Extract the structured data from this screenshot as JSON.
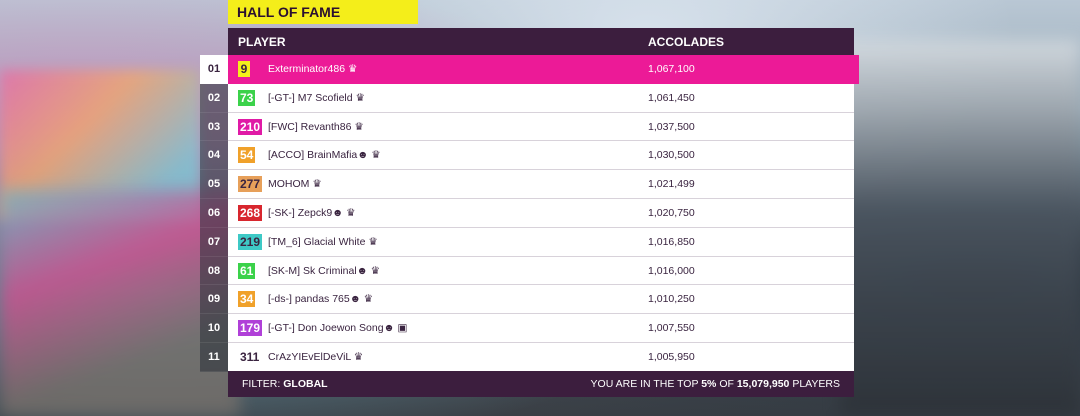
{
  "title": "HALL OF FAME",
  "headers": {
    "player": "PLAYER",
    "accolades": "ACCOLADES"
  },
  "rows": [
    {
      "rank": "01",
      "level": "9",
      "level_color": "#f4ee1a",
      "level_text_color": "#3a2440",
      "name": "Exterminator486 ♛",
      "accolades": "1,067,100",
      "highlight": true
    },
    {
      "rank": "02",
      "level": "73",
      "level_color": "#3bd24a",
      "level_text_color": "#ffffff",
      "name": "[-GT-] M7 Scofield ♛",
      "accolades": "1,061,450"
    },
    {
      "rank": "03",
      "level": "210",
      "level_color": "#e01aa6",
      "level_text_color": "#ffffff",
      "name": "[FWC] Revanth86 ♛",
      "accolades": "1,037,500"
    },
    {
      "rank": "04",
      "level": "54",
      "level_color": "#f0a12a",
      "level_text_color": "#ffffff",
      "name": "[ACCO] BrainMafia☻ ♛",
      "accolades": "1,030,500"
    },
    {
      "rank": "05",
      "level": "277",
      "level_color": "#e7a05a",
      "level_text_color": "#3a2440",
      "name": "MOHOM ♛",
      "accolades": "1,021,499"
    },
    {
      "rank": "06",
      "level": "268",
      "level_color": "#d8262e",
      "level_text_color": "#ffffff",
      "name": "[-SK-] Zepck9☻ ♛",
      "accolades": "1,020,750"
    },
    {
      "rank": "07",
      "level": "219",
      "level_color": "#3ec9c6",
      "level_text_color": "#3a2440",
      "name": "[TM_6] Glacial White ♛",
      "accolades": "1,016,850"
    },
    {
      "rank": "08",
      "level": "61",
      "level_color": "#3bd24a",
      "level_text_color": "#ffffff",
      "name": "[SK-M] Sk Criminal☻ ♛",
      "accolades": "1,016,000"
    },
    {
      "rank": "09",
      "level": "34",
      "level_color": "#f0a12a",
      "level_text_color": "#ffffff",
      "name": "[-ds-] pandas 765☻ ♛",
      "accolades": "1,010,250"
    },
    {
      "rank": "10",
      "level": "179",
      "level_color": "#b040d8",
      "level_text_color": "#ffffff",
      "name": "[-GT-] Don Joewon Song☻ ▣",
      "accolades": "1,007,550"
    },
    {
      "rank": "11",
      "level": "311",
      "level_color": "#ffffff",
      "level_text_color": "#3a2440",
      "name": "CrAzYIEvElDeViL ♛",
      "accolades": "1,005,950"
    }
  ],
  "footer": {
    "filter_label": "FILTER:",
    "filter_value": "GLOBAL",
    "top_prefix": "YOU ARE IN THE TOP",
    "top_percent": "5%",
    "top_of": "OF",
    "total_players": "15,079,950",
    "players_label": "PLAYERS"
  },
  "colors": {
    "accent": "#ec1a97",
    "panel_dark": "#3c1e3e",
    "title_bg": "#f4ee1a"
  }
}
